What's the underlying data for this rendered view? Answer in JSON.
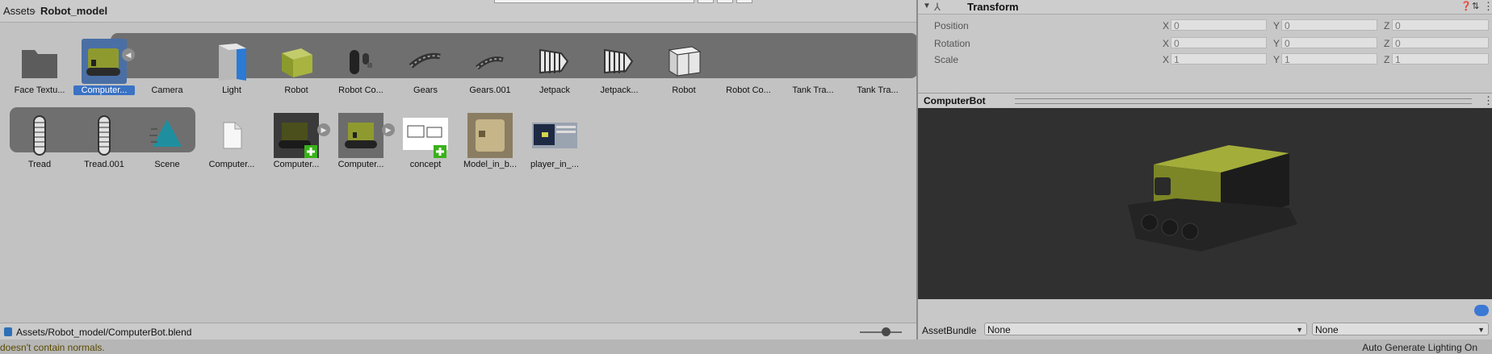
{
  "breadcrumb": [
    "Assets",
    "Robot_model"
  ],
  "assets_row1": [
    {
      "label": "Face Textu...",
      "icon": "folder-icon"
    },
    {
      "label": "Computer...",
      "icon": "model-prefab-icon",
      "selected": true
    },
    {
      "label": "Camera",
      "icon": "camera-icon"
    },
    {
      "label": "Light",
      "icon": "light-icon"
    },
    {
      "label": "Robot",
      "icon": "mesh-cube-icon"
    },
    {
      "label": "Robot Co...",
      "icon": "mesh-parts-icon"
    },
    {
      "label": "Gears",
      "icon": "gears-mesh-icon"
    },
    {
      "label": "Gears.001",
      "icon": "gears-mesh-icon"
    },
    {
      "label": "Jetpack",
      "icon": "jetpack-mesh-icon"
    },
    {
      "label": "Jetpack...",
      "icon": "jetpack-mesh-icon"
    },
    {
      "label": "Robot",
      "icon": "robot-mesh-icon"
    },
    {
      "label": "Robot Co...",
      "icon": "empty"
    },
    {
      "label": "Tank Tra...",
      "icon": "empty"
    },
    {
      "label": "Tank Tra...",
      "icon": "empty"
    }
  ],
  "assets_row2": [
    {
      "label": "Tread",
      "icon": "tread-mesh-icon"
    },
    {
      "label": "Tread.001",
      "icon": "tread-mesh-icon"
    },
    {
      "label": "Scene",
      "icon": "scene-icon"
    },
    {
      "label": "Computer...",
      "icon": "file-icon"
    },
    {
      "label": "Computer...",
      "icon": "prefab-dark-icon"
    },
    {
      "label": "Computer...",
      "icon": "prefab-icon"
    },
    {
      "label": "concept",
      "icon": "concept-image-icon"
    },
    {
      "label": "Model_in_b...",
      "icon": "texture-icon"
    },
    {
      "label": "player_in_...",
      "icon": "screenshot-icon"
    }
  ],
  "path_bar": {
    "path": "Assets/Robot_model/ComputerBot.blend"
  },
  "status": {
    "left": "doesn't contain normals.",
    "right": "Auto Generate Lighting On"
  },
  "inspector": {
    "component": "Transform",
    "rows": [
      {
        "label": "Position",
        "x": "0",
        "y": "0",
        "z": "0"
      },
      {
        "label": "Rotation",
        "x": "0",
        "y": "0",
        "z": "0"
      },
      {
        "label": "Scale",
        "x": "1",
        "y": "1",
        "z": "1"
      }
    ],
    "axis_labels": [
      "X",
      "Y",
      "Z"
    ],
    "preview_title": "ComputerBot",
    "assetbundle": {
      "label": "AssetBundle",
      "name": "None",
      "variant": "None"
    }
  },
  "colors": {
    "selection": "#3a72c4",
    "strip": "#6f6f6f",
    "preview_bg": "#303030",
    "olive": "#8f9a2e"
  }
}
